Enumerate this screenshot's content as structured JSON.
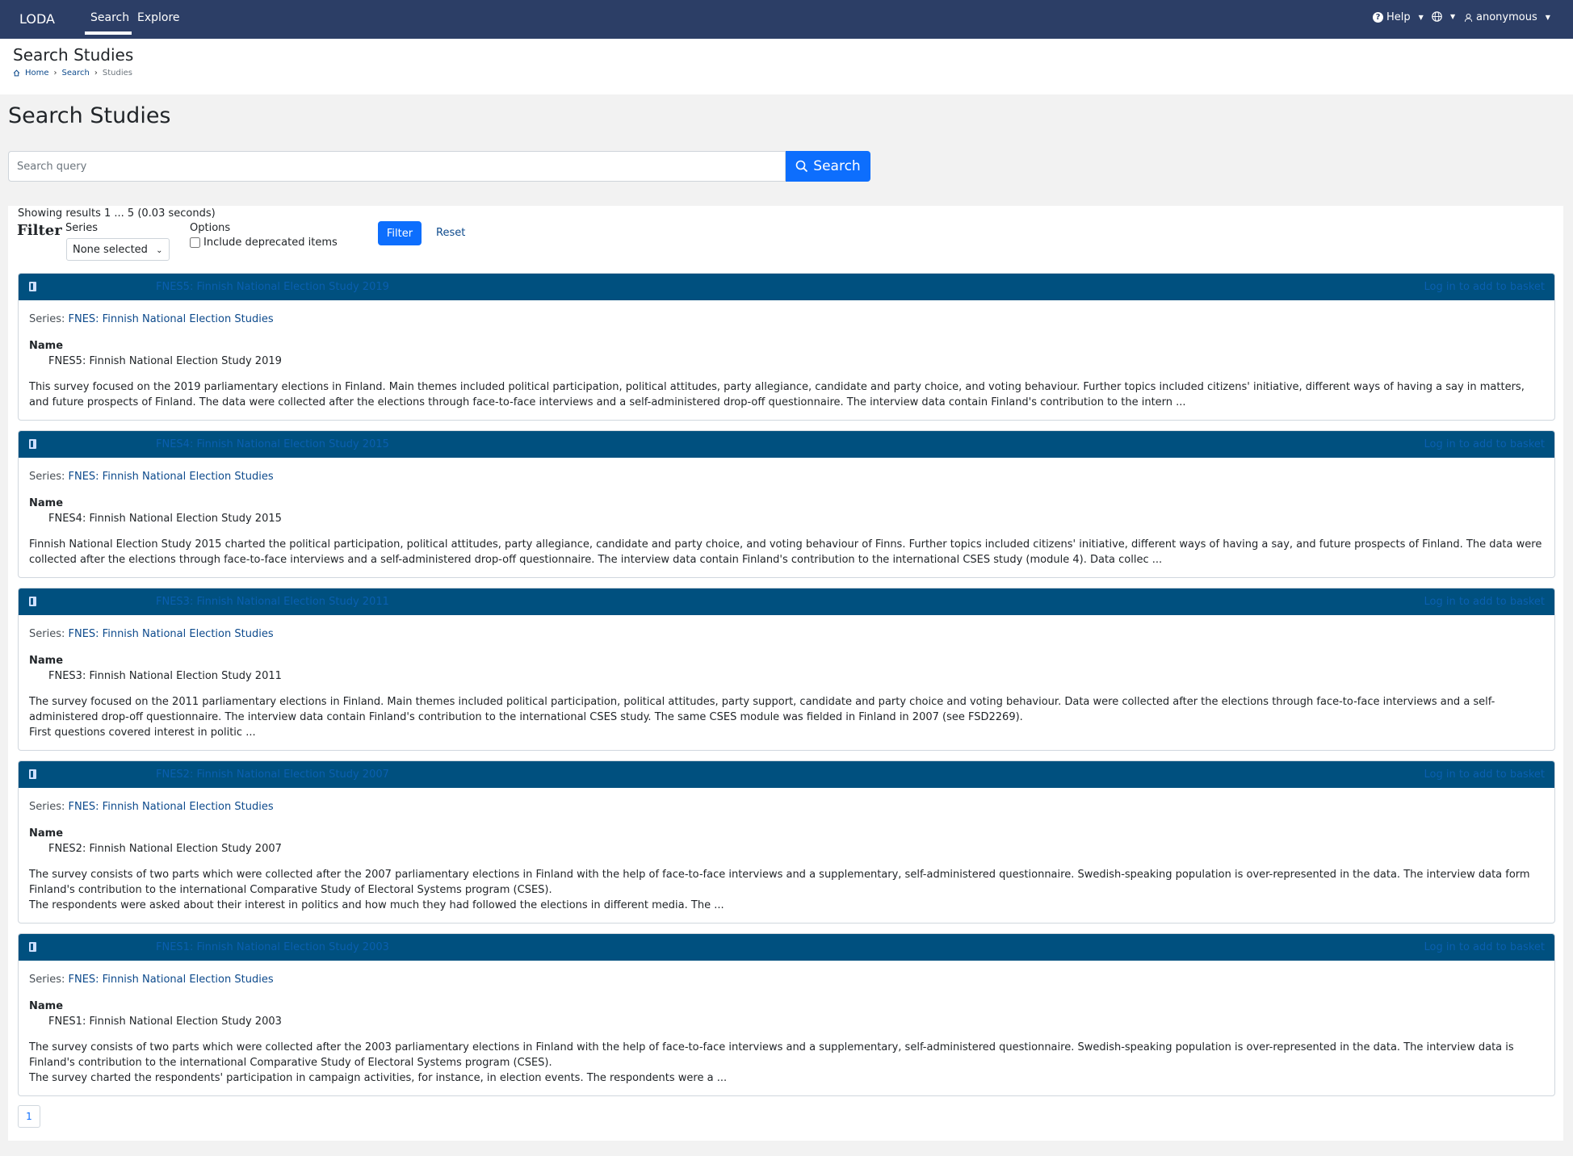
{
  "nav": {
    "brand": "LODA",
    "search": "Search",
    "explore": "Explore",
    "help": "Help",
    "user": "anonymous"
  },
  "header": {
    "title": "Search Studies",
    "breadcrumb": {
      "home": "Home",
      "search": "Search",
      "current": "Studies"
    }
  },
  "page": {
    "title": "Search Studies",
    "search_placeholder": "Search query",
    "search_button": "Search"
  },
  "results": {
    "showing": "Showing results 1 ... 5 (0.03 seconds)",
    "filter_label": "Filter",
    "series_label": "Series",
    "series_value": "None selected",
    "options_label": "Options",
    "deprecated_label": "Include deprecated items",
    "filter_button": "Filter",
    "reset_button": "Reset",
    "series_prefix": "Series:",
    "name_label": "Name",
    "basket_label": "Log in to add to basket",
    "items": [
      {
        "title": "FNES5: Finnish National Election Study 2019",
        "series": "FNES: Finnish National Election Studies",
        "name": "FNES5: Finnish National Election Study 2019",
        "abstract": "This survey focused on the 2019 parliamentary elections in Finland. Main themes included political participation, political attitudes, party allegiance, candidate and party choice, and voting behaviour. Further topics included citizens' initiative, different ways of having a say in matters, and future prospects of Finland. The data were collected after the elections through face-to-face interviews and a self-administered drop-off questionnaire. The interview data contain Finland's contribution to the intern ..."
      },
      {
        "title": "FNES4: Finnish National Election Study 2015",
        "series": "FNES: Finnish National Election Studies",
        "name": "FNES4: Finnish National Election Study 2015",
        "abstract": "Finnish National Election Study 2015 charted the political participation, political attitudes, party allegiance, candidate and party choice, and voting behaviour of Finns. Further topics included citizens' initiative, different ways of having a say, and future prospects of Finland. The data were collected after the elections through face-to-face interviews and a self-administered drop-off questionnaire. The interview data contain Finland's contribution to the international CSES study (module 4). Data collec ..."
      },
      {
        "title": "FNES3: Finnish National Election Study 2011",
        "series": "FNES: Finnish National Election Studies",
        "name": "FNES3: Finnish National Election Study 2011",
        "abstract": "The survey focused on the 2011 parliamentary elections in Finland. Main themes included political participation, political attitudes, party support, candidate and party choice and voting behaviour. Data were collected after the elections through face-to-face interviews and a self-administered drop-off questionnaire. The interview data contain Finland's contribution to the international CSES study. The same CSES module was fielded in Finland in 2007 (see FSD2269).\nFirst questions covered interest in politic ..."
      },
      {
        "title": "FNES2: Finnish National Election Study 2007",
        "series": "FNES: Finnish National Election Studies",
        "name": "FNES2: Finnish National Election Study 2007",
        "abstract": "The survey consists of two parts which were collected after the 2007 parliamentary elections in Finland with the help of face-to-face interviews and a supplementary, self-administered questionnaire. Swedish-speaking population is over-represented in the data. The interview data form Finland's contribution to the international Comparative Study of Electoral Systems program (CSES).\nThe respondents were asked about their interest in politics and how much they had followed the elections in different media. The ..."
      },
      {
        "title": "FNES1: Finnish National Election Study 2003",
        "series": "FNES: Finnish National Election Studies",
        "name": "FNES1: Finnish National Election Study 2003",
        "abstract": "The survey consists of two parts which were collected after the 2003 parliamentary elections in Finland with the help of face-to-face interviews and a supplementary, self-administered questionnaire. Swedish-speaking population is over-represented in the data. The interview data is Finland's contribution to the international Comparative Study of Electoral Systems program (CSES).\nThe survey charted the respondents' participation in campaign activities, for instance, in election events. The respondents were a ..."
      }
    ],
    "page_number": "1"
  },
  "colors": {
    "navbar": "#2c3e66",
    "card_header": "#00507f",
    "primary": "#0d6efd",
    "link": "#0d4a8c"
  }
}
